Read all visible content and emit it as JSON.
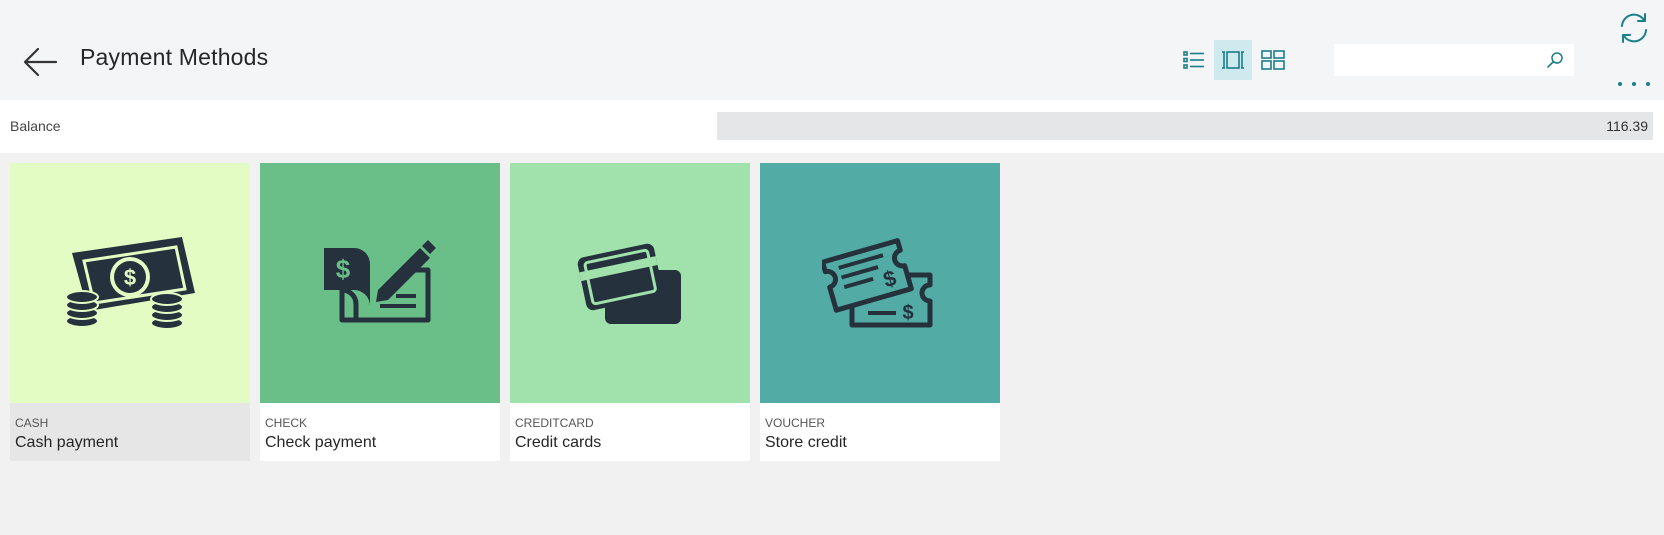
{
  "page": {
    "title": "Payment Methods"
  },
  "toolbar": {
    "views": [
      {
        "name": "list-view",
        "icon": "list-icon",
        "active": false
      },
      {
        "name": "tall-tiles-view",
        "icon": "tall-tiles-icon",
        "active": true
      },
      {
        "name": "tiles-view",
        "icon": "grid-icon",
        "active": false
      }
    ],
    "search": {
      "value": "",
      "placeholder": ""
    },
    "accent_color": "#1a7f8a"
  },
  "balance": {
    "label": "Balance",
    "value": "116.39"
  },
  "tiles": [
    {
      "code": "CASH",
      "description": "Cash payment",
      "icon": "cash-icon",
      "bg": "#e3fcc3",
      "footer_bg": "#e6e6e6"
    },
    {
      "code": "CHECK",
      "description": "Check payment",
      "icon": "check-icon",
      "bg": "#6abe87",
      "footer_bg": "#ffffff"
    },
    {
      "code": "CREDITCARD",
      "description": "Credit cards",
      "icon": "credit-card-icon",
      "bg": "#a1e1ab",
      "footer_bg": "#ffffff"
    },
    {
      "code": "VOUCHER",
      "description": "Store credit",
      "icon": "voucher-icon",
      "bg": "#52aba5",
      "footer_bg": "#ffffff"
    }
  ]
}
